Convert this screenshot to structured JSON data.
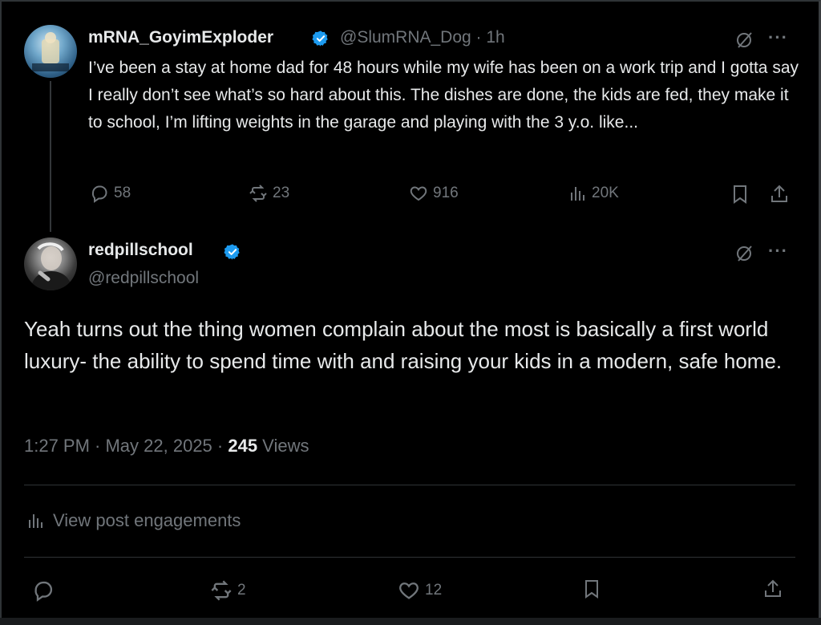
{
  "parent_post": {
    "display_name": "mRNA_GoyimExploder",
    "handle_time": "@SlumRNA_Dog · 1h",
    "text": "I’ve been a stay at home dad for 48 hours while my wife has been on a work trip and I gotta say I really don’t see what’s so hard about this. The dishes are done, the kids are fed, they make it to school, I’m lifting weights in the garage and playing with the 3 y.o. like...",
    "replies": "58",
    "reposts": "23",
    "likes": "916",
    "views": "20K"
  },
  "main_post": {
    "display_name": "redpillschool",
    "handle": "@redpillschool",
    "text": "Yeah turns out the thing women complain about the most is basically a first world luxury- the ability to spend time with and raising your kids in a modern, safe  home.",
    "timestamp": "1:27 PM · May 22, 2025 · ",
    "views_count": "245",
    "views_label": " Views",
    "engagements_label": "View post engagements",
    "replies": "",
    "reposts": "2",
    "likes": "12"
  },
  "colors": {
    "accent": "#1d9bf0",
    "muted": "#71767b",
    "text": "#e7e9ea"
  },
  "icons": [
    "verified-badge-icon",
    "grok-icon",
    "more-icon",
    "reply-icon",
    "repost-icon",
    "like-icon",
    "views-icon",
    "bookmark-icon",
    "share-icon"
  ]
}
